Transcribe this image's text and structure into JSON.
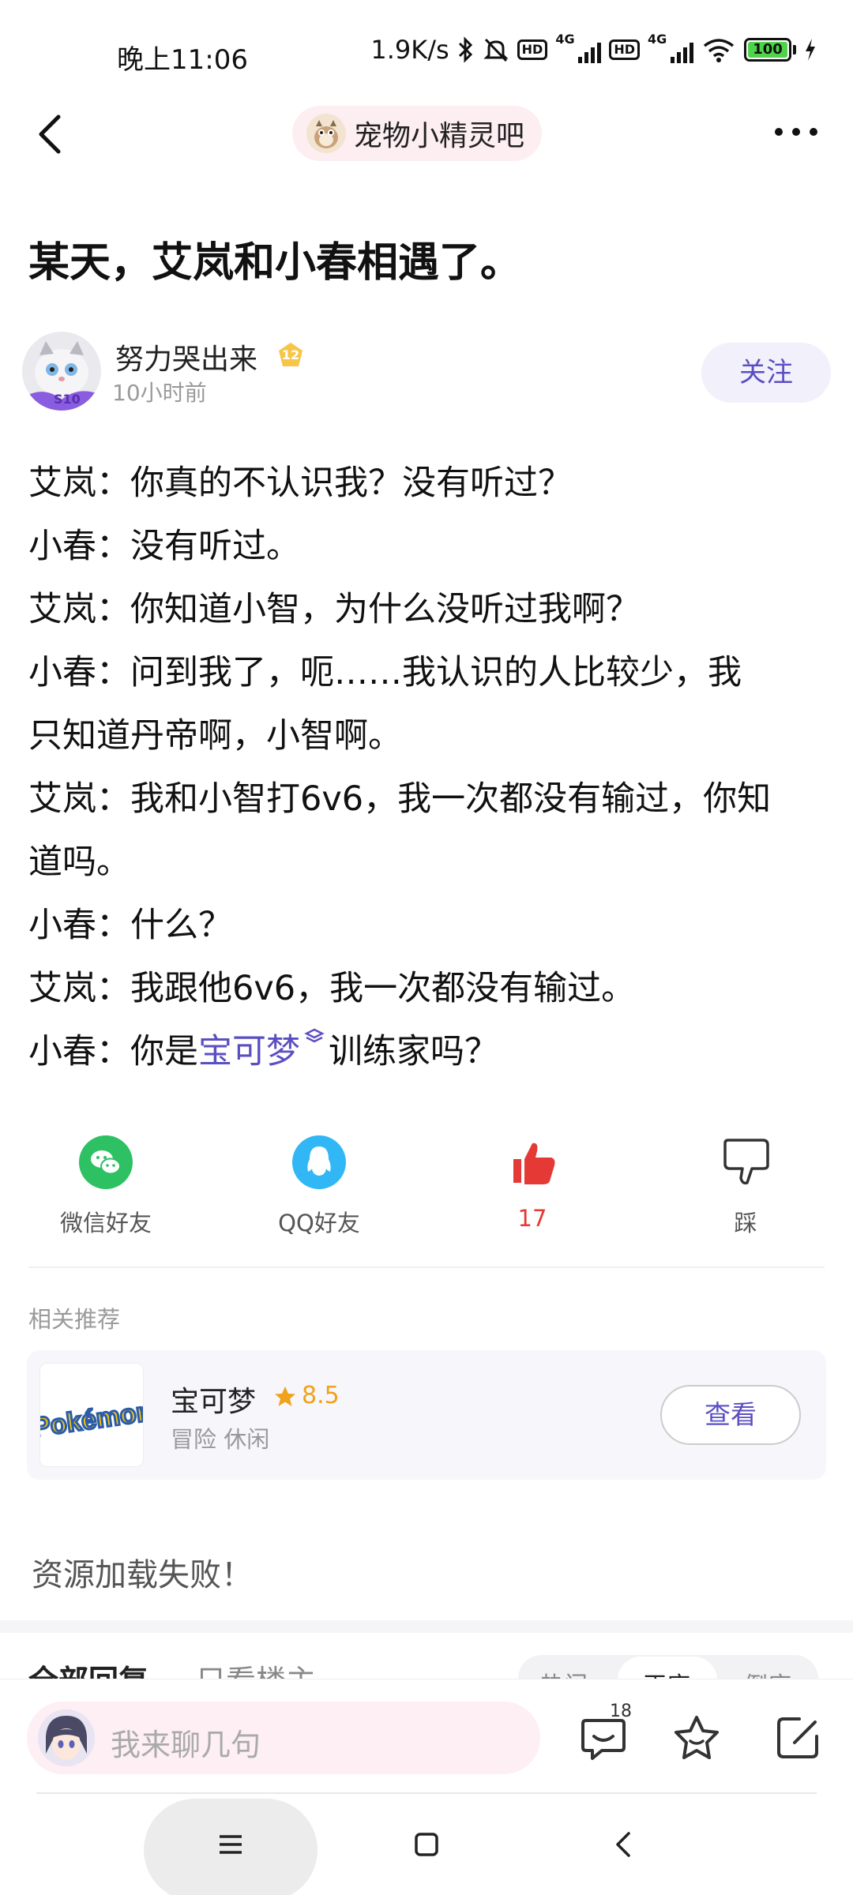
{
  "status_bar": {
    "time": "晚上11:06",
    "net_speed": "1.9K/s",
    "sim1": "4G",
    "sim2": "4G",
    "hd": "HD",
    "battery": "100"
  },
  "nav": {
    "forum_name": "宠物小精灵吧"
  },
  "post": {
    "title": "某天，艾岚和小春相遇了。",
    "author": {
      "name": "努力哭出来",
      "level": "12",
      "avatar_badge": "S10",
      "time": "10小时前",
      "follow_label": "关注"
    },
    "lines": [
      "艾岚：你真的不认识我？没有听过？",
      "小春：没有听过。",
      "艾岚：你知道小智，为什么没听过我啊？",
      "小春：问到我了，呃……我认识的人比较少，我",
      "只知道丹帝啊，小智啊。",
      "艾岚：我和小智打6v6，我一次都没有输过，你知",
      "道吗。",
      "小春：什么？",
      "艾岚：我跟他6v6，我一次都没有输过。"
    ],
    "last_line": {
      "prefix": "小春：你是",
      "link": "宝可梦",
      "suffix": "训练家吗？"
    }
  },
  "actions": {
    "wechat": "微信好友",
    "qq": "QQ好友",
    "like_count": "17",
    "dislike": "踩"
  },
  "related": {
    "label": "相关推荐",
    "game_name": "宝可梦",
    "score": "8.5",
    "tags": "冒险  休闲",
    "view_label": "查看",
    "logo_text": "Pokémon"
  },
  "load_error": "资源加载失败！",
  "reply_tabs": {
    "all": "全部回复",
    "owner": "只看楼主",
    "sort": [
      "热门",
      "正序",
      "倒序"
    ]
  },
  "bottom": {
    "placeholder": "我来聊几句",
    "comment_count": "18"
  },
  "colors": {
    "accent": "#5a4fc2",
    "like": "#e53935",
    "wechat": "#2dc163",
    "qq": "#31b7f5",
    "star": "#f0a21a"
  }
}
